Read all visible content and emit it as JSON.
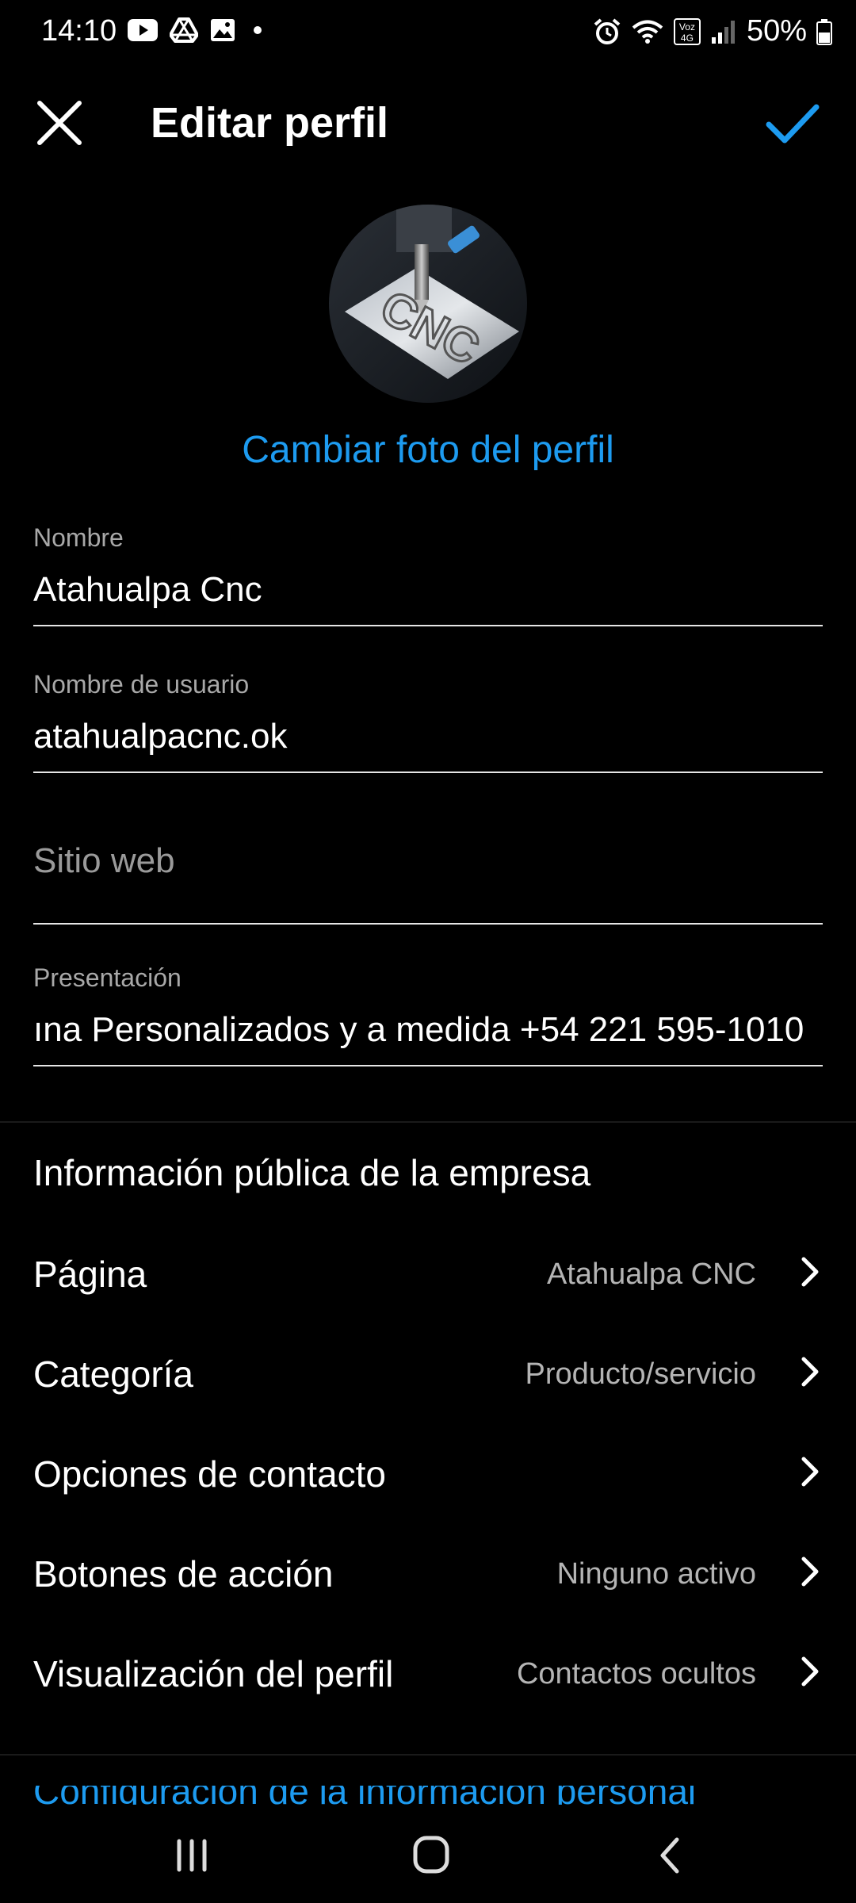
{
  "status_bar": {
    "time": "14:10",
    "battery": "50%",
    "left_icons": [
      "youtube-icon",
      "drive-icon",
      "gallery-icon",
      "dot-icon"
    ],
    "right_icons": [
      "alarm-icon",
      "wifi-icon",
      "volte-icon",
      "signal-icon",
      "battery-icon"
    ],
    "volte_label": "Voz 4G"
  },
  "header": {
    "title": "Editar perfil",
    "close_icon": "close-icon",
    "confirm_icon": "check-icon"
  },
  "avatar": {
    "text": "CNC",
    "change_photo_label": "Cambiar foto del perfil"
  },
  "fields": {
    "name": {
      "label": "Nombre",
      "value": "Atahualpa Cnc"
    },
    "username": {
      "label": "Nombre de usuario",
      "value": "atahualpacnc.ok"
    },
    "website": {
      "placeholder": "Sitio web"
    },
    "bio": {
      "label": "Presentación",
      "value": "ına Personalizados y a medida +54 221 595-1010"
    }
  },
  "business_info": {
    "title": "Información pública de la empresa",
    "rows": [
      {
        "label": "Página",
        "value": "Atahualpa CNC"
      },
      {
        "label": "Categoría",
        "value": "Producto/servicio"
      },
      {
        "label": "Opciones de contacto",
        "value": ""
      },
      {
        "label": "Botones de acción",
        "value": "Ninguno activo"
      },
      {
        "label": "Visualización del perfil",
        "value": "Contactos ocultos"
      }
    ]
  },
  "cut_off_link": "Configuración de la información personal",
  "nav_bar": {
    "buttons": [
      "recents-icon",
      "home-icon",
      "back-icon"
    ]
  },
  "colors": {
    "accent": "#1d9bf0",
    "background": "#000000",
    "secondary_text": "#a8a8a8"
  }
}
